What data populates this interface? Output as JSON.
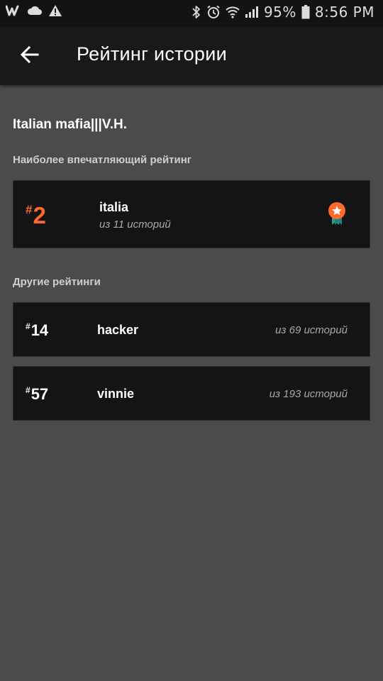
{
  "status_bar": {
    "battery_percent": "95%",
    "time": "8:56 PM",
    "left_icons": [
      "wattpad-icon",
      "cloud-icon",
      "warning-icon"
    ],
    "right_icons": [
      "bluetooth-icon",
      "alarm-icon",
      "wifi-icon",
      "signal-icon",
      "battery-icon"
    ]
  },
  "appbar": {
    "title": "Рейтинг истории",
    "back_icon": "arrow-left-icon"
  },
  "story": {
    "title": "Italian mafia|||V.H."
  },
  "featured_section": {
    "label": "Наиболее впечатляющий рейтинг",
    "item": {
      "hash": "#",
      "rank": "2",
      "tag": "italia",
      "out_of": "из 11 историй",
      "badge_icon": "award-ribbon-icon"
    }
  },
  "other_section": {
    "label": "Другие рейтинги",
    "items": [
      {
        "hash": "#",
        "rank": "14",
        "tag": "hacker",
        "out_of": "из 69 историй"
      },
      {
        "hash": "#",
        "rank": "57",
        "tag": "vinnie",
        "out_of": "из 193 историй"
      }
    ]
  },
  "colors": {
    "accent": "#ff6a2c",
    "background": "#4b4a4d",
    "card": "#141316",
    "appbar": "#19181a",
    "badge_ribbon": "#2a9d8f"
  }
}
